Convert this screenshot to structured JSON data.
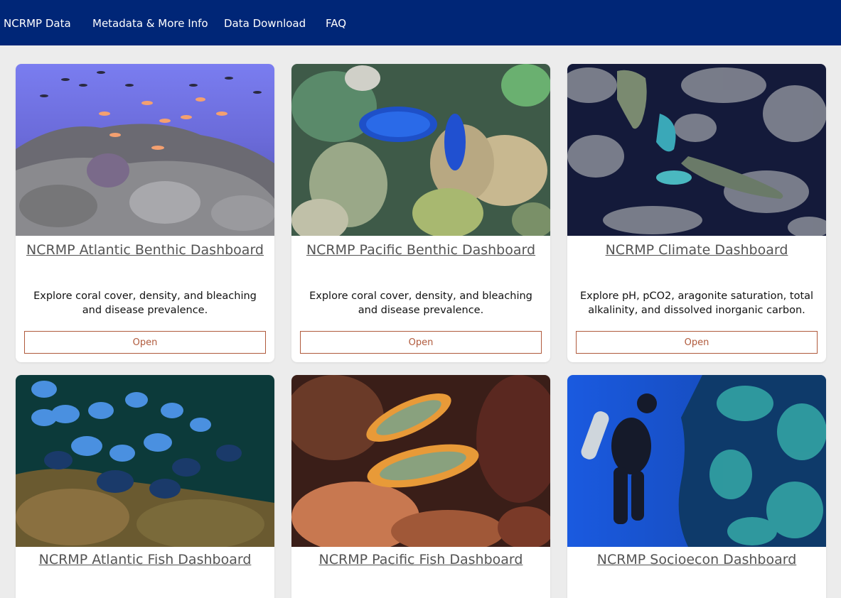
{
  "nav": {
    "items": [
      {
        "label": "NCRMP Data"
      },
      {
        "label": "Metadata & More Info"
      },
      {
        "label": "Data Download"
      },
      {
        "label": "FAQ"
      }
    ]
  },
  "colors": {
    "navbar": "#002677",
    "page_background": "#ececec",
    "button_accent": "#b05a3c",
    "title_text": "#545454"
  },
  "cards": [
    {
      "title": "NCRMP Atlantic Benthic Dashboard",
      "description": "Explore coral cover, density, and bleaching and disease prevalence.",
      "button": "Open",
      "image": "atlantic-reef-fish-photo"
    },
    {
      "title": "NCRMP Pacific Benthic Dashboard",
      "description": "Explore coral cover, density, and bleaching and disease prevalence.",
      "button": "Open",
      "image": "giant-clam-coral-photo"
    },
    {
      "title": "NCRMP Climate Dashboard",
      "description": "Explore pH, pCO2, aragonite saturation, total alkalinity, and dissolved inorganic carbon.",
      "button": "Open",
      "image": "satellite-florida-cuba-photo"
    },
    {
      "title": "NCRMP Atlantic Fish Dashboard",
      "description": "",
      "button": "",
      "image": "blue-tang-school-photo"
    },
    {
      "title": "NCRMP Pacific Fish Dashboard",
      "description": "",
      "button": "",
      "image": "wrasse-pair-photo"
    },
    {
      "title": "NCRMP Socioecon Dashboard",
      "description": "",
      "button": "",
      "image": "scuba-diver-photo"
    }
  ]
}
